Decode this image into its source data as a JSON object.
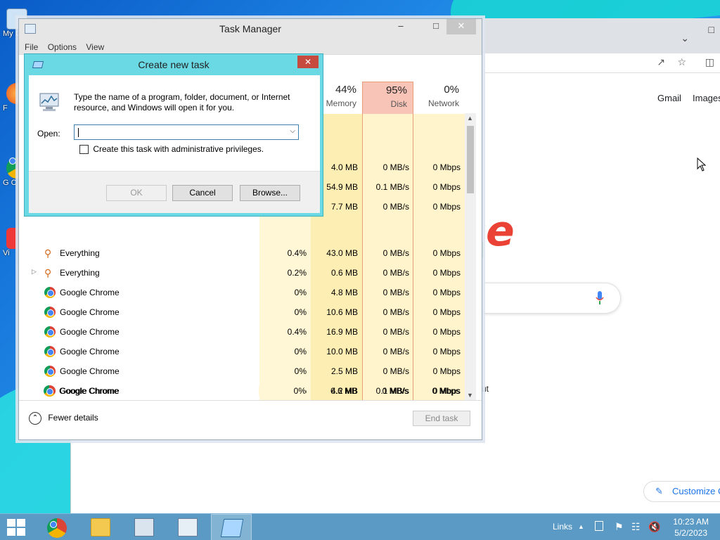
{
  "desktop": {
    "icons": [
      {
        "label": "My C"
      },
      {
        "label": "F"
      },
      {
        "label": "G C"
      },
      {
        "label": "Vi"
      }
    ]
  },
  "chrome": {
    "links": [
      "Gmail",
      "Images"
    ],
    "partial_logo_letter": "e",
    "partial_text": "ut",
    "customize_label": "Customize C"
  },
  "task_manager": {
    "title": "Task Manager",
    "menu": [
      "File",
      "Options",
      "View"
    ],
    "columns": [
      {
        "pct": "44%",
        "name": "Memory"
      },
      {
        "pct": "95%",
        "name": "Disk"
      },
      {
        "pct": "0%",
        "name": "Network"
      }
    ],
    "partial_rows": [
      {
        "memory": "4.0 MB",
        "disk": "0 MB/s",
        "network": "0 Mbps"
      },
      {
        "memory": "54.9 MB",
        "disk": "0.1 MB/s",
        "network": "0 Mbps"
      },
      {
        "memory": "7.7 MB",
        "disk": "0 MB/s",
        "network": "0 Mbps"
      }
    ],
    "rows": [
      {
        "name": "Everything",
        "icon": "search-key-icon",
        "expandable": false,
        "cpu": "0.4%",
        "memory": "43.0 MB",
        "disk": "0 MB/s",
        "network": "0 Mbps"
      },
      {
        "name": "Everything",
        "icon": "search-key-icon",
        "expandable": true,
        "cpu": "0.2%",
        "memory": "0.6 MB",
        "disk": "0 MB/s",
        "network": "0 Mbps"
      },
      {
        "name": "Google Chrome",
        "icon": "chrome-icon",
        "expandable": false,
        "cpu": "0%",
        "memory": "4.8 MB",
        "disk": "0 MB/s",
        "network": "0 Mbps"
      },
      {
        "name": "Google Chrome",
        "icon": "chrome-icon",
        "expandable": false,
        "cpu": "0%",
        "memory": "10.6 MB",
        "disk": "0 MB/s",
        "network": "0 Mbps"
      },
      {
        "name": "Google Chrome",
        "icon": "chrome-icon",
        "expandable": false,
        "cpu": "0.4%",
        "memory": "16.9 MB",
        "disk": "0 MB/s",
        "network": "0 Mbps"
      },
      {
        "name": "Google Chrome",
        "icon": "chrome-icon",
        "expandable": false,
        "cpu": "0%",
        "memory": "10.0 MB",
        "disk": "0 MB/s",
        "network": "0 Mbps"
      },
      {
        "name": "Google Chrome",
        "icon": "chrome-icon",
        "expandable": false,
        "cpu": "0%",
        "memory": "2.5 MB",
        "disk": "0 MB/s",
        "network": "0 Mbps"
      },
      {
        "name": "Google Chrome",
        "icon": "chrome-icon",
        "expandable": false,
        "cpu": "0%",
        "memory": "4.2 MB",
        "disk": "0.1 MB/s",
        "network": "0 Mbps"
      },
      {
        "name": "Google Chrome",
        "icon": "chrome-icon",
        "expandable": false,
        "cpu": "0%",
        "memory": "6.6 MB",
        "disk": "0 MB/s",
        "network": "0 Mbps"
      }
    ],
    "fewer_details": "Fewer details",
    "end_task": "End task"
  },
  "dialog": {
    "title": "Create new task",
    "message": "Type the name of a program, folder, document, or Internet resource, and Windows will open it for you.",
    "open_label": "Open:",
    "open_value": "",
    "admin_checkbox_label": "Create this task with administrative privileges.",
    "admin_checked": false,
    "ok": "OK",
    "cancel": "Cancel",
    "browse": "Browse..."
  },
  "taskbar": {
    "apps": [
      "chrome-icon",
      "file-explorer-icon",
      "keyboard-monitor-icon",
      "task-manager-icon",
      "run-dialog-icon"
    ],
    "active_app": "run-dialog-icon",
    "links_label": "Links",
    "time": "10:23 AM",
    "date": "5/2/2023"
  },
  "colors": {
    "dialog_frame": "#6ad9e4",
    "disk_header": "#f8c4b8",
    "heat_light": "#fff4cc",
    "heat_medium": "#fdeeb3",
    "close_red": "#c74a3f",
    "taskbar": "#5a9ac5"
  }
}
